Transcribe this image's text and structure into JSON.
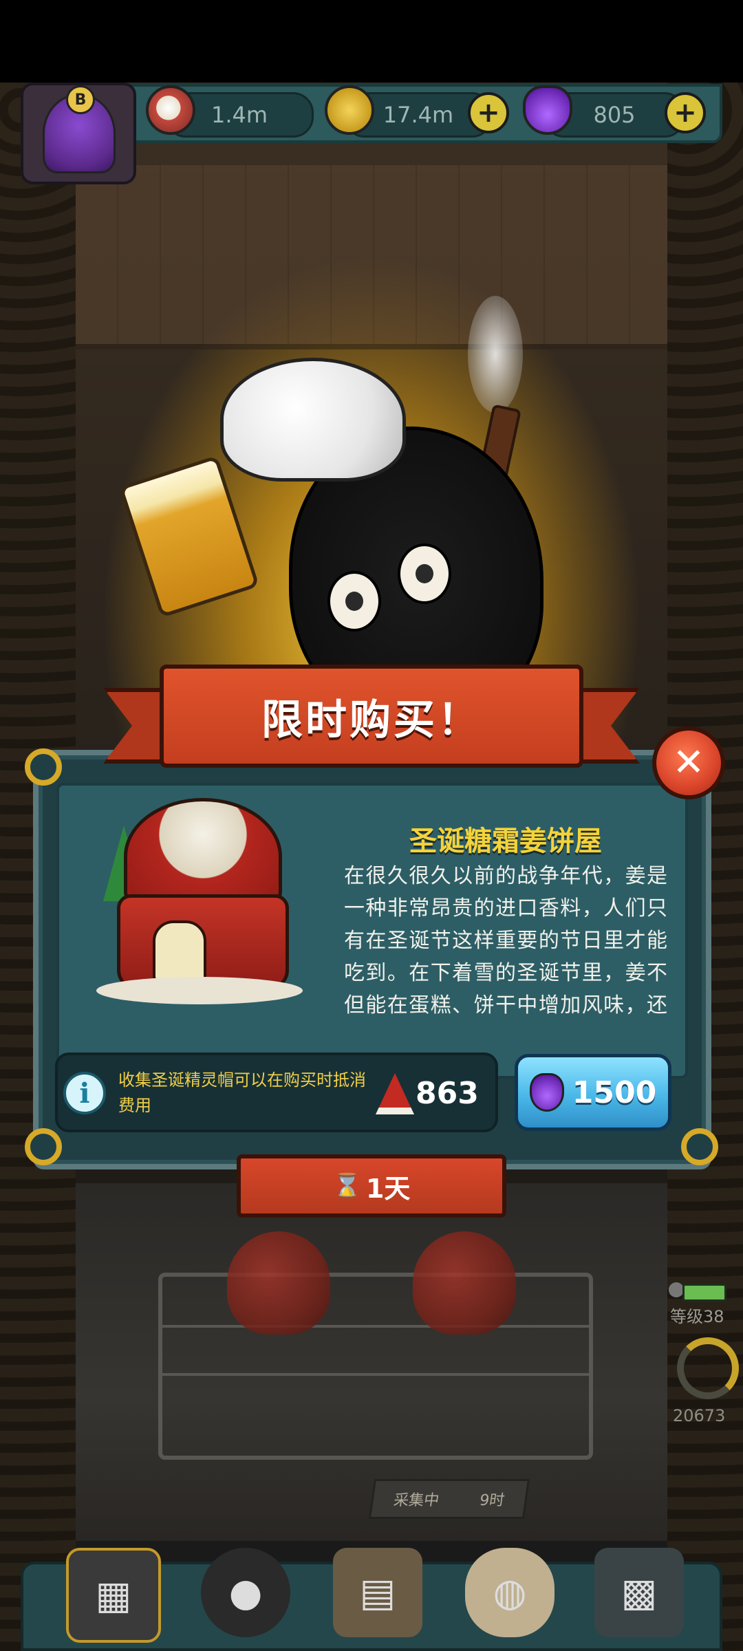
{
  "hud": {
    "eyes": "1.4m",
    "coins": "17.4m",
    "potions": "805",
    "avatar_letter": "B"
  },
  "offer": {
    "title": "限时购买！",
    "item_name": "圣诞糖霜姜饼屋",
    "description": "在很久很久以前的战争年代，姜是一种非常昂贵的进口香料，人们只有在圣诞节这样重要的节日里才能吃到。在下着雪的圣诞节里，姜不但能在蛋糕、饼干中增加风味，还可以驱走严寒。微溶的糖霜包裹住姜饼，让圣诞",
    "info_text": "收集圣诞精灵帽可以在购买时抵消费用",
    "hat_count": "863",
    "price": "1500",
    "timer": "1天",
    "close_symbol": "✕",
    "info_symbol": "i"
  },
  "world": {
    "collect_label": "采集中",
    "collect_time": "9时",
    "level_label": "等级38",
    "gauge_value": "20673"
  },
  "icons": {
    "hourglass": "⌛"
  }
}
